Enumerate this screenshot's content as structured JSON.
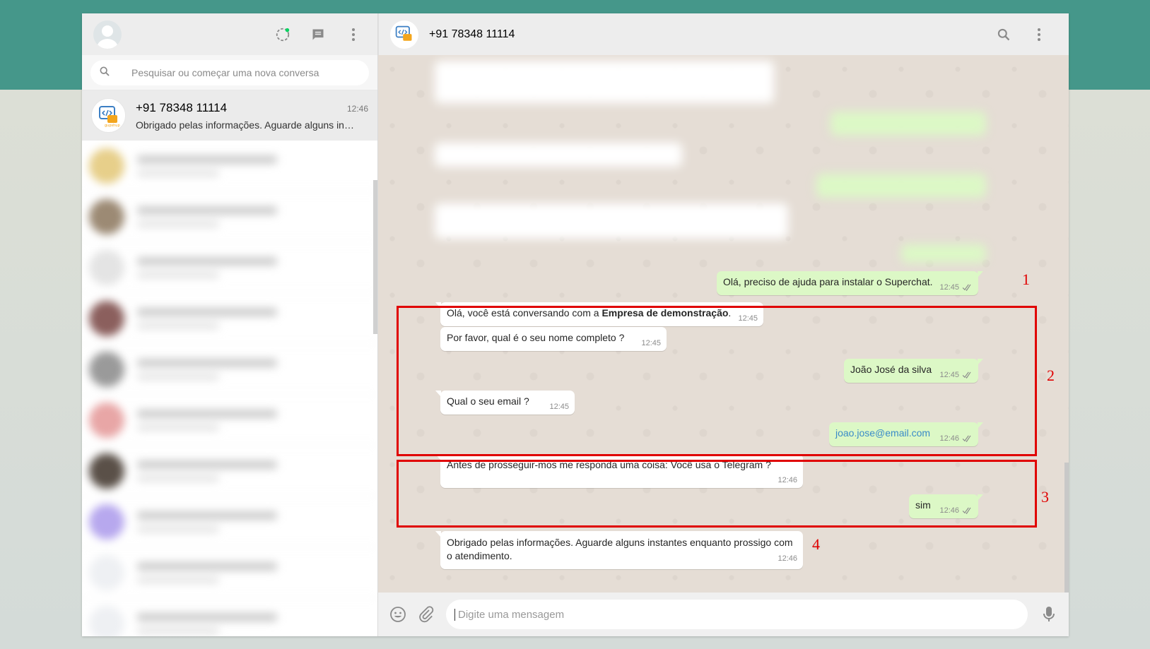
{
  "sidebar": {
    "search_placeholder": "Pesquisar ou começar uma nova conversa",
    "active_chat": {
      "name": "+91 78348 11114",
      "time": "12:46",
      "preview": "Obrigado pelas informações. Aguarde alguns in…"
    }
  },
  "header": {
    "title": "+91 78348 11114"
  },
  "messages": {
    "m1": {
      "text": "Olá, preciso de ajuda para instalar o Superchat.",
      "time": "12:45"
    },
    "m2": {
      "prefix": "Olá, você está conversando com a ",
      "bold": "Empresa de demonstração",
      "suffix": ".",
      "time": "12:45"
    },
    "m3": {
      "text": "Por favor, qual é o seu nome completo ?",
      "time": "12:45"
    },
    "m4": {
      "text": "João José da silva",
      "time": "12:45"
    },
    "m5": {
      "text": "Qual o seu email ?",
      "time": "12:45"
    },
    "m6": {
      "text": "joao.jose@email.com",
      "time": "12:46"
    },
    "m7": {
      "text": "Antes de prosseguir-mos me responda uma coisa: Você usa o Telegram ?",
      "time": "12:46"
    },
    "m8": {
      "text": "sim",
      "time": "12:46"
    },
    "m9": {
      "text": "Obrigado pelas informações. Aguarde alguns instantes enquanto prossigo com o atendimento.",
      "time": "12:46"
    }
  },
  "annotations": [
    "1",
    "2",
    "3",
    "4"
  ],
  "composer": {
    "placeholder": "Digite uma mensagem"
  },
  "colors": {
    "highlight": "#e00000",
    "outgoing": "#dcf8c6",
    "header_band": "#45978a"
  }
}
